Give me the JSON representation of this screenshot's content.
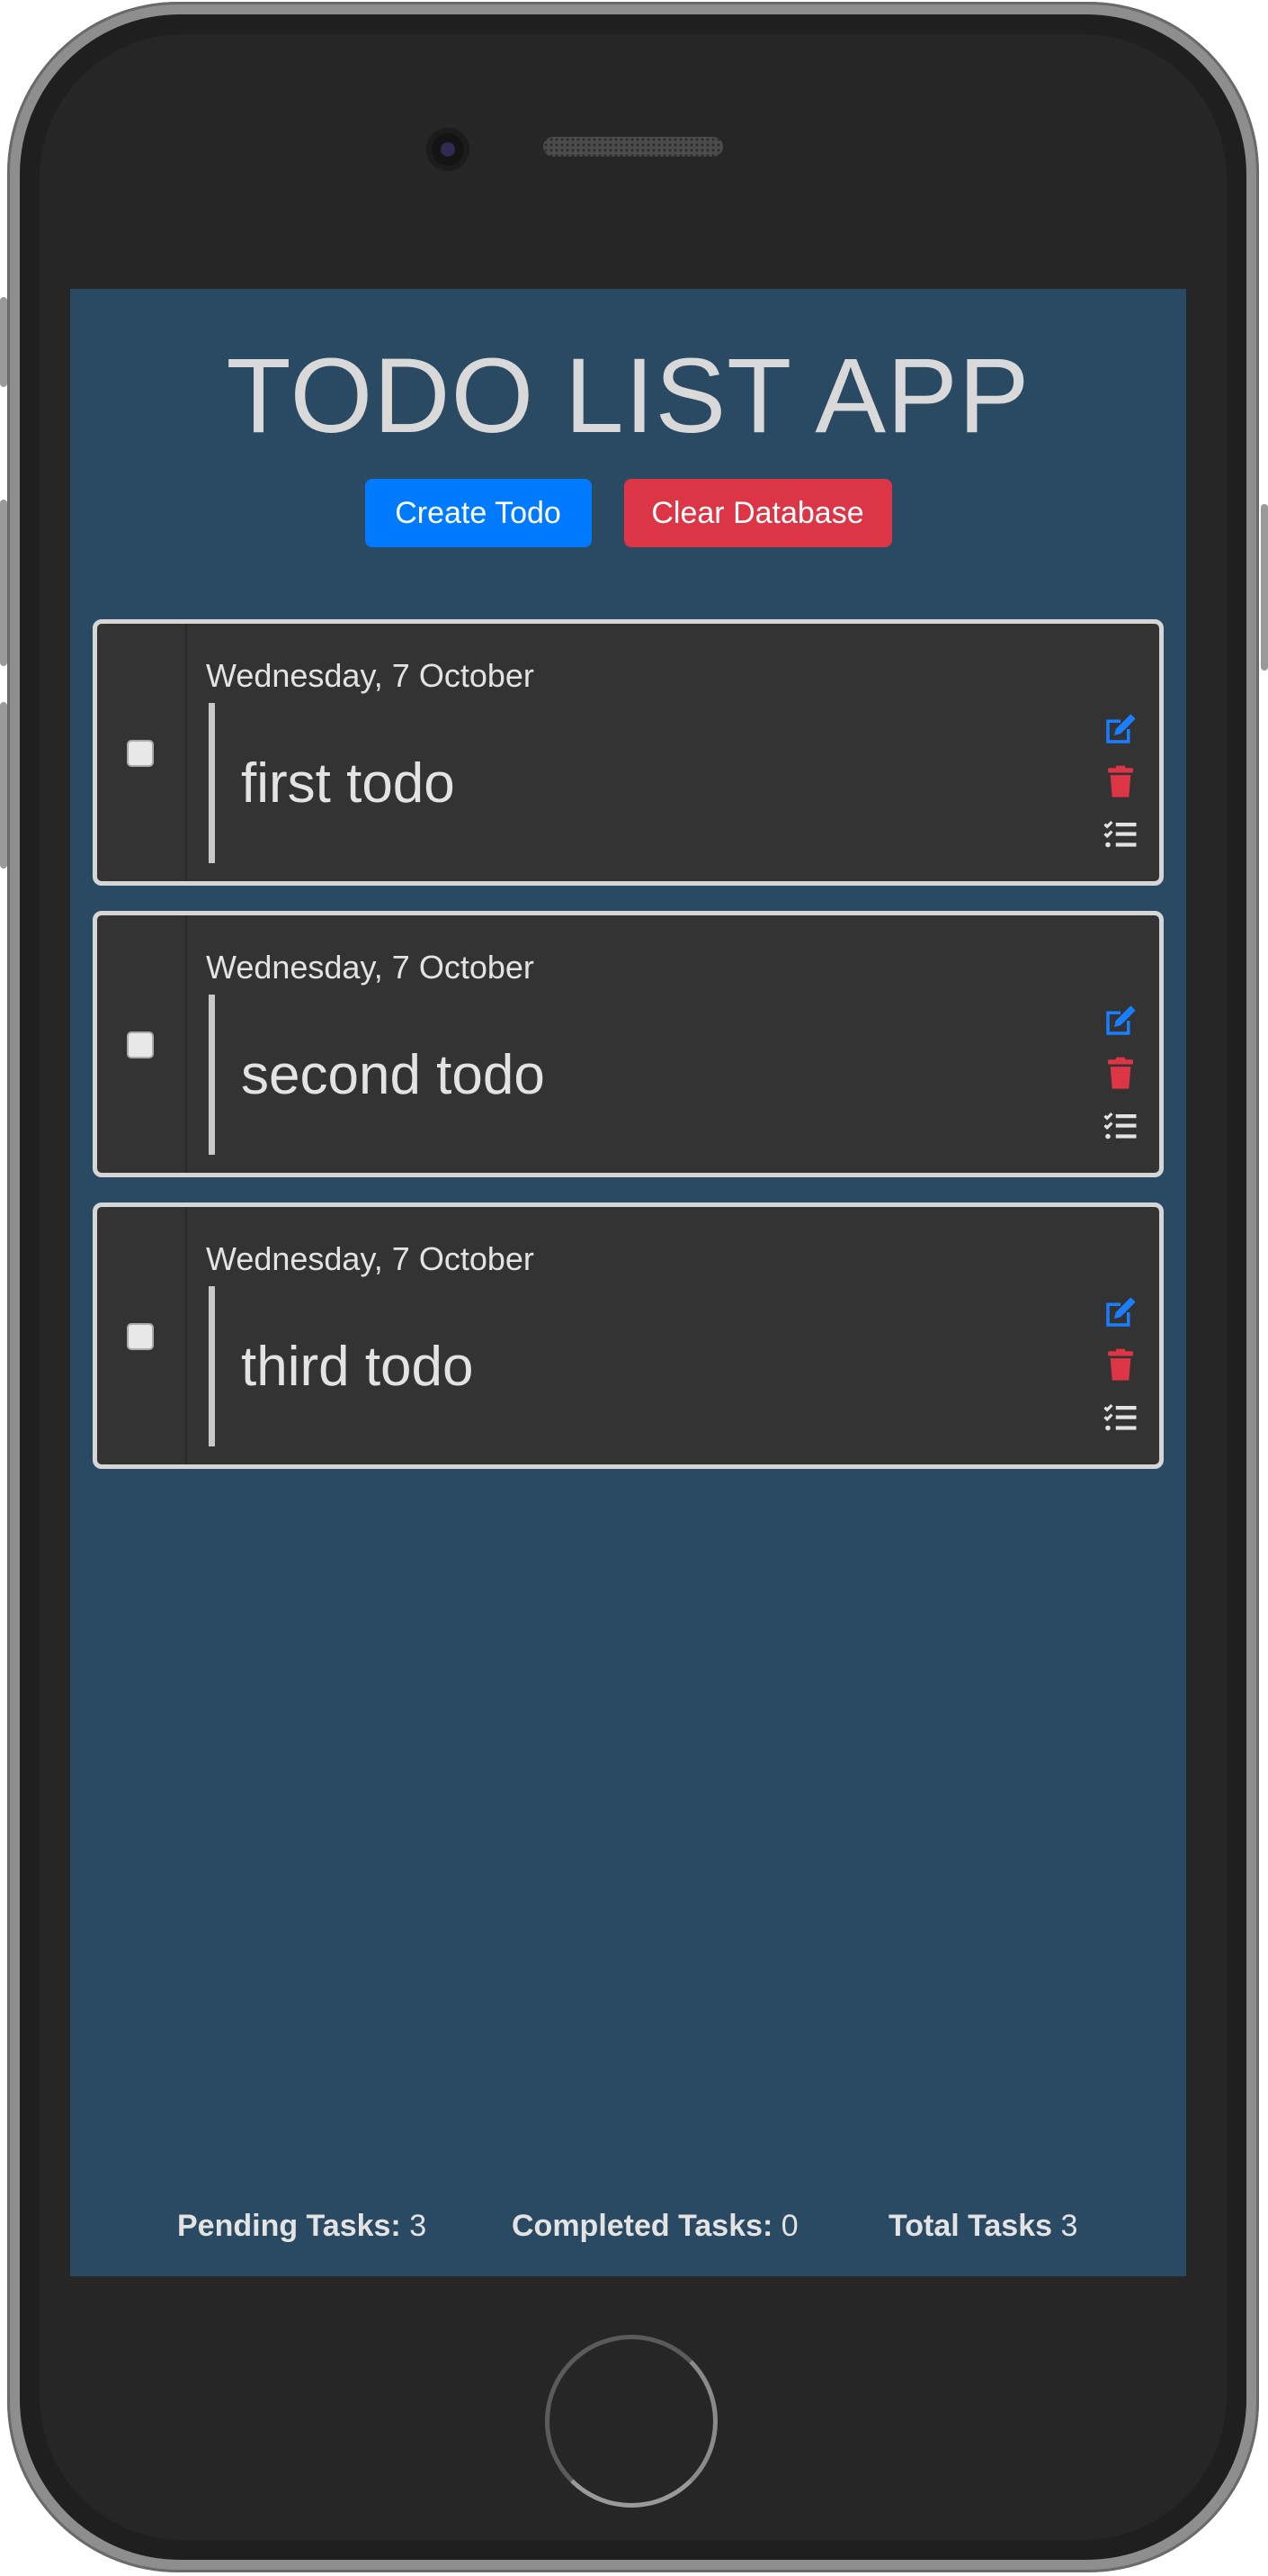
{
  "app": {
    "title": "TODO LIST APP",
    "create_label": "Create Todo",
    "clear_label": "Clear Database"
  },
  "todos": [
    {
      "date": "Wednesday, 7 October",
      "text": "first todo",
      "completed": false
    },
    {
      "date": "Wednesday, 7 October",
      "text": "second todo",
      "completed": false
    },
    {
      "date": "Wednesday, 7 October",
      "text": "third todo",
      "completed": false
    }
  ],
  "icons": {
    "edit": "edit-icon",
    "delete": "trash-icon",
    "subtasks": "tasks-list-icon"
  },
  "footer": {
    "pending_label": "Pending Tasks:",
    "pending_value": "3",
    "completed_label": "Completed Tasks:",
    "completed_value": "0",
    "total_label": "Total Tasks",
    "total_value": "3"
  },
  "colors": {
    "background": "#2a4a63",
    "card": "#333333",
    "primary": "#007bff",
    "danger": "#dc3545"
  }
}
